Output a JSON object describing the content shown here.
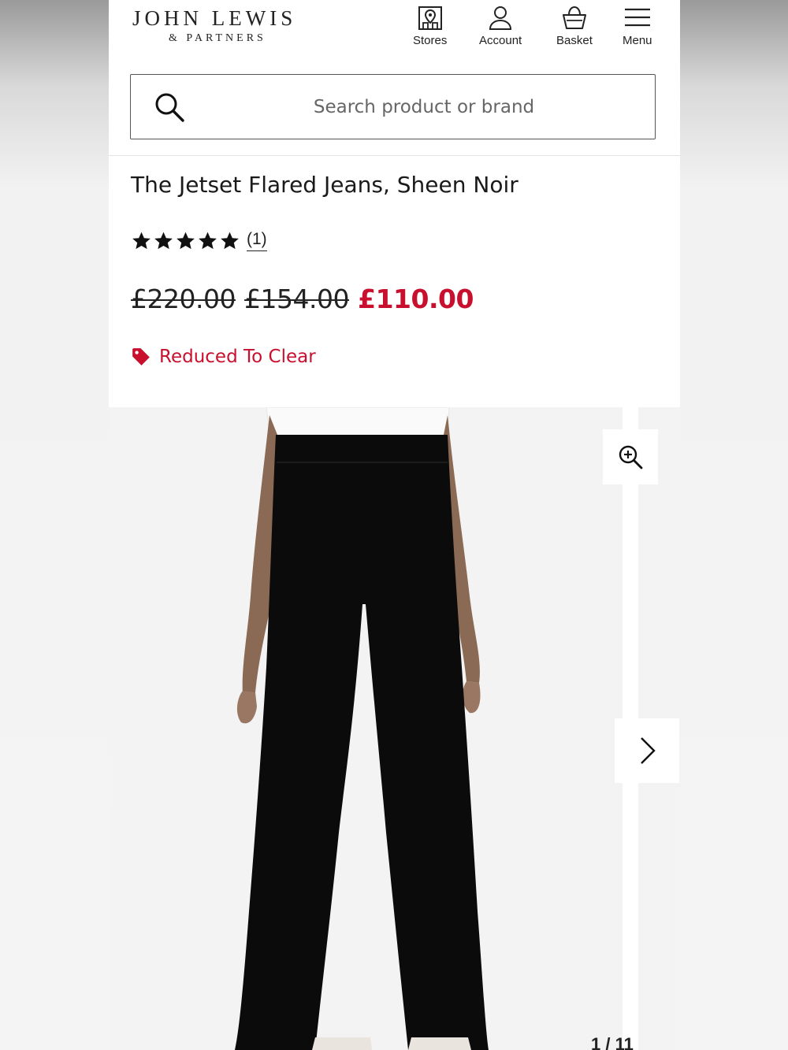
{
  "header": {
    "logo_main": "JOHN LEWIS",
    "logo_sub": "& PARTNERS",
    "nav": {
      "stores": "Stores",
      "account": "Account",
      "basket": "Basket",
      "menu": "Menu"
    }
  },
  "search": {
    "placeholder": "Search product or brand",
    "value": ""
  },
  "product": {
    "title": "The Jetset Flared Jeans, Sheen Noir",
    "rating": 5,
    "review_count": "(1)",
    "price_original": "£220.00",
    "price_previous": "£154.00",
    "price_current": "£110.00",
    "promo_label": "Reduced To Clear"
  },
  "gallery": {
    "counter": "1 / 11"
  },
  "colors": {
    "accent_red": "#c8102e",
    "text_dark": "#222222"
  }
}
